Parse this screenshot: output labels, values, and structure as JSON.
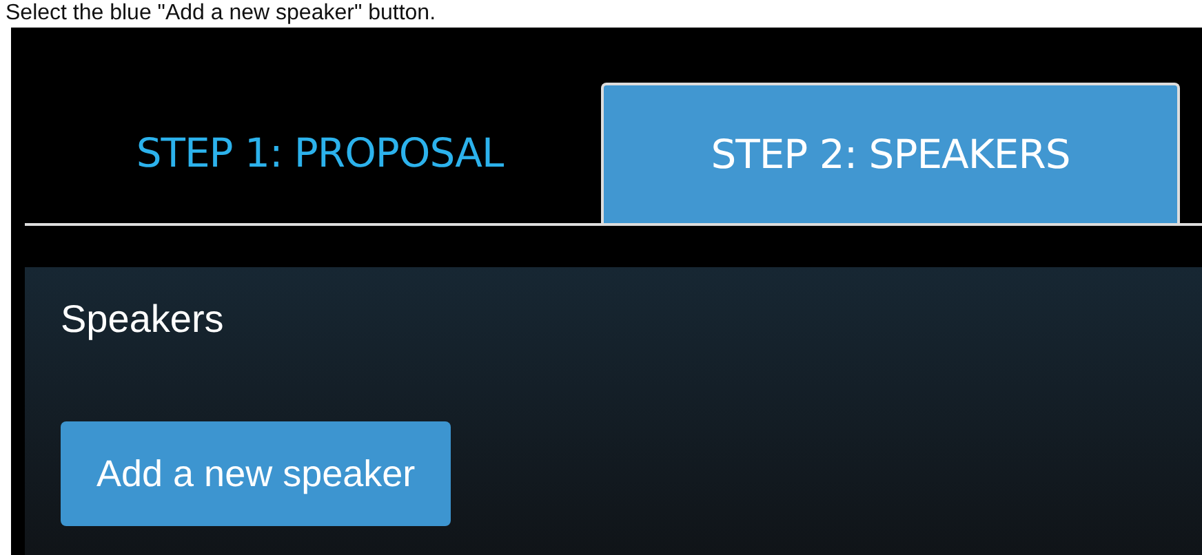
{
  "caption": "Select the blue \"Add a new speaker\" button.",
  "tabs": [
    {
      "label": "STEP 1: PROPOSAL",
      "selected": false
    },
    {
      "label": "STEP 2: SPEAKERS",
      "selected": true
    }
  ],
  "panel": {
    "title": "Speakers",
    "button": "Add a new speaker"
  }
}
